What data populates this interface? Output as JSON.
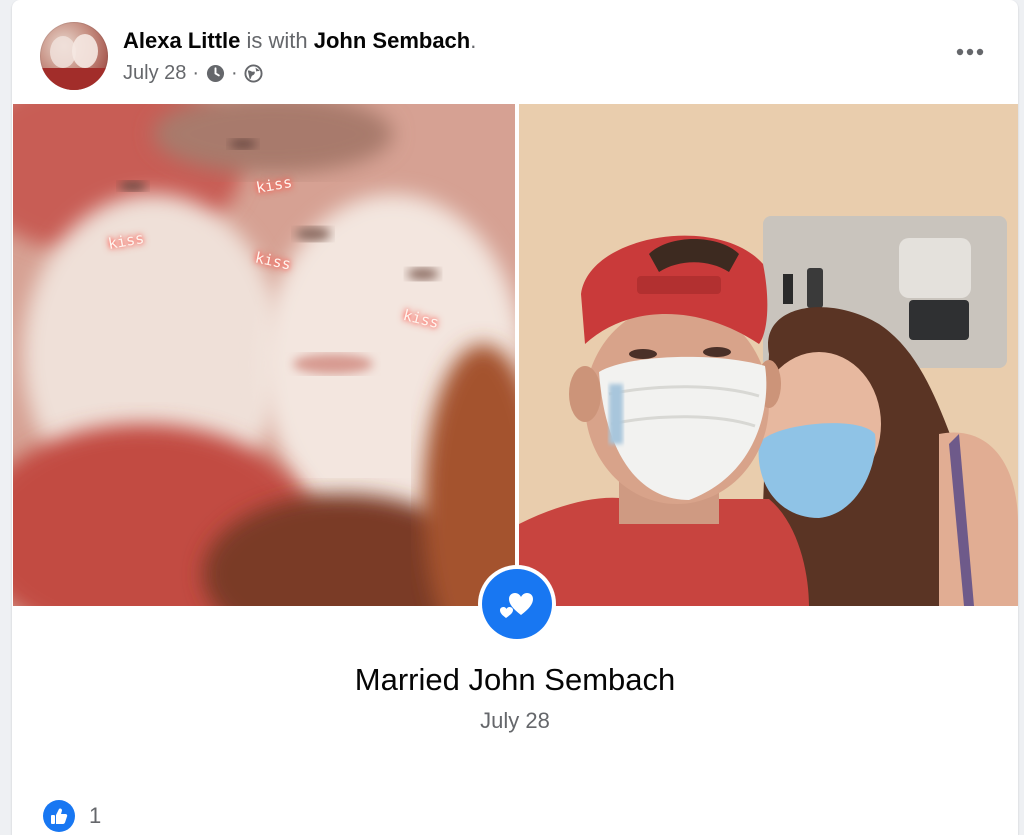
{
  "post": {
    "author": "Alexa Little",
    "with_text": "is with",
    "tagged": "John Sembach",
    "period": ".",
    "date": "July 28",
    "dot": "·",
    "time_icon": "clock-icon",
    "privacy_icon": "globe-icon",
    "more_icon": "more-options-icon"
  },
  "photos": {
    "left_overlay": [
      "kiss",
      "kiss",
      "kiss",
      "kiss"
    ]
  },
  "life_event": {
    "icon": "hearts-icon",
    "title": "Married John Sembach",
    "date": "July 28"
  },
  "reactions": {
    "icon": "like-icon",
    "count": "1"
  },
  "colors": {
    "accent": "#1877f2",
    "primary_text": "#050505",
    "secondary_text": "#65676b"
  }
}
